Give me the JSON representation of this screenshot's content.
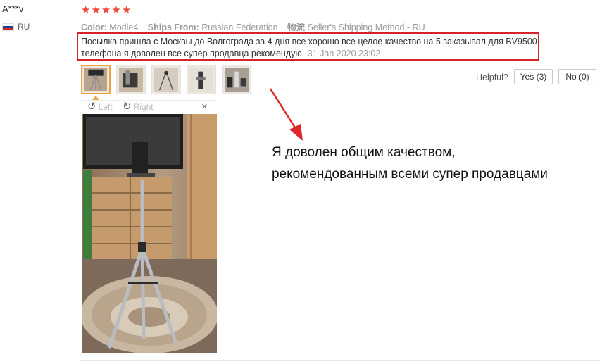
{
  "reviewer": {
    "name": "A***v",
    "country": "RU"
  },
  "rating": {
    "stars": 5,
    "max": 5,
    "star_glyph": "★",
    "color": "#f0463c"
  },
  "meta": {
    "color_label": "Color:",
    "color_value": "Modle4",
    "ships_label": "Ships From:",
    "ships_value": "Russian Federation",
    "shipping_label": "物流",
    "shipping_value": "Seller's Shipping Method - RU"
  },
  "review": {
    "text": "Посылка пришла с Москвы до Волгограда за 4 дня все хорошо все целое качество на 5 заказывал для BV9500 телефона я доволен все супер продавца рекомендую",
    "date": "31 Jan 2020 23:02",
    "highlight_color": "#d4242a"
  },
  "thumbnails": [
    {
      "icon": "photo-thumbnail",
      "active": true
    },
    {
      "icon": "photo-thumbnail",
      "active": false
    },
    {
      "icon": "photo-thumbnail",
      "active": false
    },
    {
      "icon": "photo-thumbnail",
      "active": false
    },
    {
      "icon": "photo-thumbnail",
      "active": false
    }
  ],
  "helpful": {
    "label": "Helpful?",
    "yes": "Yes (3)",
    "no": "No (0)"
  },
  "viewer": {
    "rotate_left": "Left",
    "rotate_right": "Right",
    "close": "×"
  },
  "annotation": {
    "line1": "Я доволен общим качеством,",
    "line2": "рекомендованным всеми супер продавцами",
    "arrow_color": "#e0262b"
  }
}
